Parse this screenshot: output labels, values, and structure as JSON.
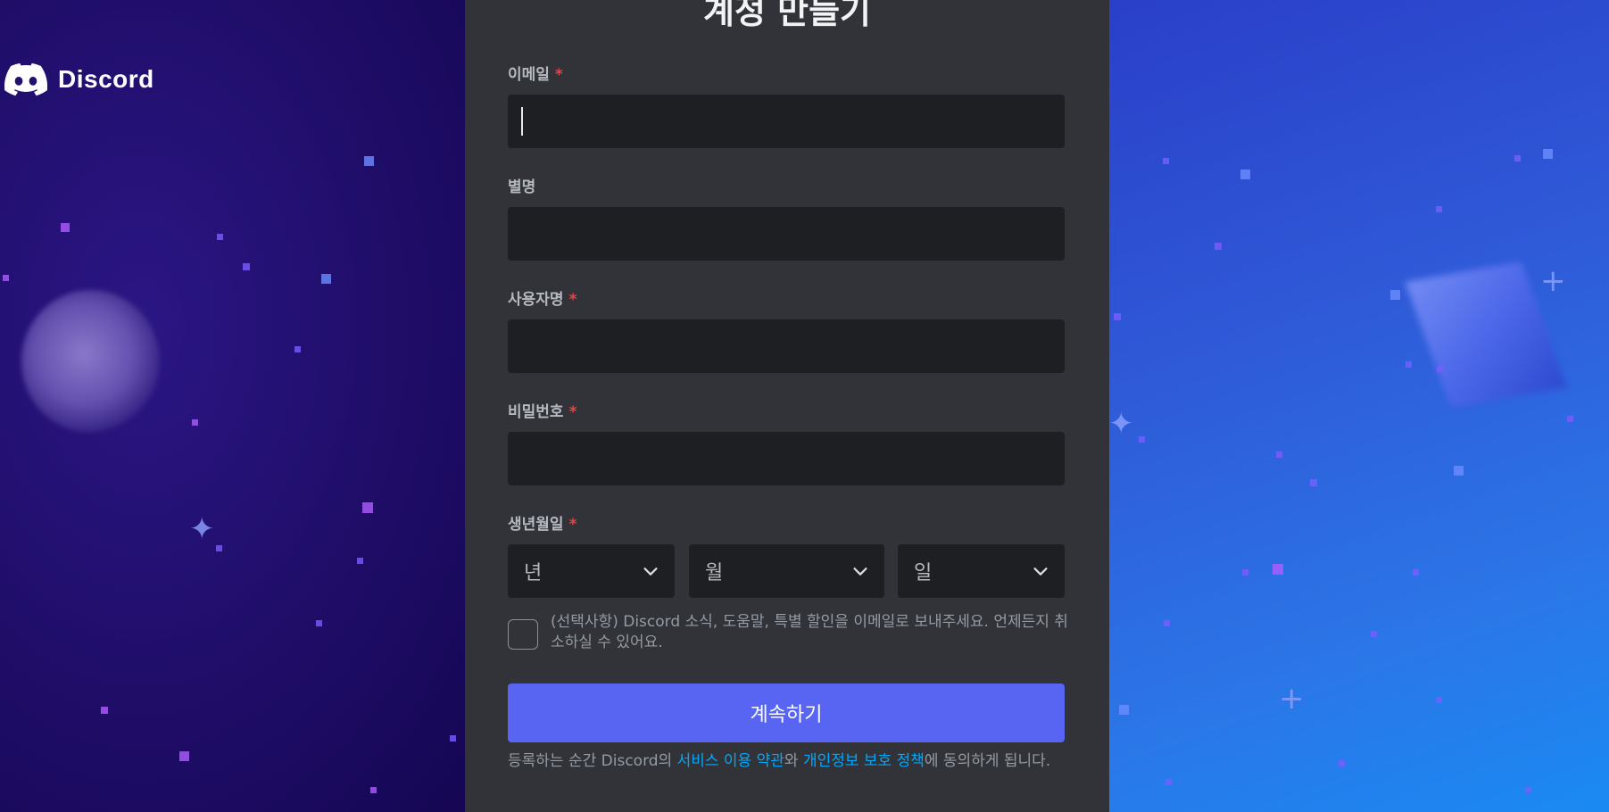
{
  "brand": {
    "name": "Discord",
    "logo_icon": "discord-logo-icon"
  },
  "form": {
    "title": "계정 만들기",
    "required_marker": "*",
    "fields": {
      "email": {
        "label": "이메일",
        "value": ""
      },
      "display_name": {
        "label": "별명",
        "value": ""
      },
      "username": {
        "label": "사용자명",
        "value": ""
      },
      "password": {
        "label": "비밀번호",
        "value": ""
      }
    },
    "birthdate": {
      "label": "생년월일",
      "year_placeholder": "년",
      "month_placeholder": "월",
      "day_placeholder": "일"
    },
    "optin_text": "(선택사항) Discord 소식, 도움말, 특별 할인을 이메일로 보내주세요. 언제든지 취소하실 수 있어요.",
    "continue_label": "계속하기",
    "legal": {
      "prefix": "등록하는 순간 Discord의 ",
      "terms_link": "서비스 이용 약관",
      "middle": "와 ",
      "privacy_link": "개인정보 보호 정책",
      "suffix": "에 동의하게 됩니다."
    }
  },
  "colors": {
    "card_bg": "#313338",
    "input_bg": "#1e1f22",
    "accent": "#5865f2",
    "link": "#00a8fc",
    "required": "#f23f42"
  }
}
